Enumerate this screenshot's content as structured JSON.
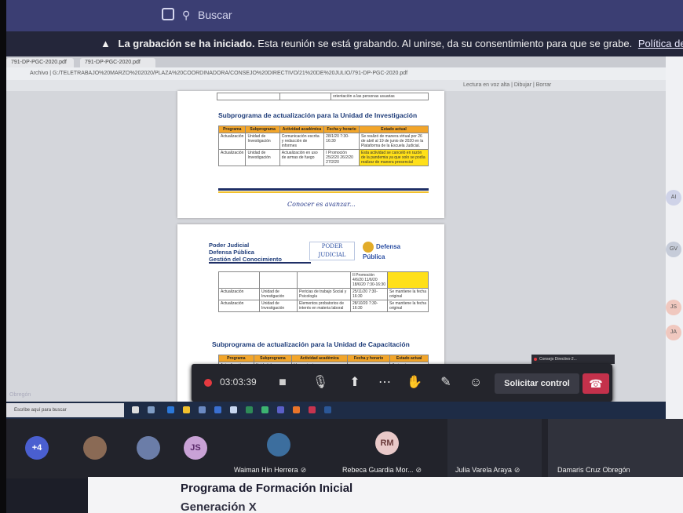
{
  "teams_top": {
    "search_label": "Buscar"
  },
  "recording_banner": {
    "bold": "La grabación se ha iniciado.",
    "text": "Esta reunión se está grabando. Al unirse, da su consentimiento para que se grabe.",
    "link": "Política de privacidad"
  },
  "browser": {
    "tabs": [
      "791-DP-PGC-2020.pdf",
      "791-DP-PGC-2020.pdf"
    ],
    "address": "Archivo | G:/TELETRABAJO%20MARZO%202020/PLAZA%20COORDINADORA/CONSEJO%20DIRECTIVO/21%20DE%20JULIO/791-DP-PGC-2020.pdf",
    "pdf_toolbar": "Lectura en voz alta | Dibujar | Borrar"
  },
  "pdf": {
    "page1": {
      "top_row_text": "orientación a las personas usuarias",
      "subheading": "Subprograma de actualización para la Unidad de Investigación",
      "table_headers": [
        "Programa",
        "Subprograma",
        "Actividad académica",
        "Fecha y horario",
        "Estado actual"
      ],
      "rows": [
        [
          "Actualización",
          "Unidad de Investigación",
          "Comunicación escrita y redacción de informes",
          "28/1/20  7:30-16:30",
          "Se realizó de manera virtual por 26 de abril al 19 de junio de 2020 en la Plataforma de la Escuela Judicial."
        ],
        [
          "Actualización",
          "Unidad de Investigación",
          "Actualización en uso de armas de fuego",
          "I Promoción 25/2/20 26/2/20 27/2/20",
          "Esta actividad se canceló en razón de la pandemia ya que solo se podía realizar de manera presencial"
        ]
      ],
      "motto": "Conocer es avanzar..."
    },
    "page2": {
      "header_lines": [
        "Poder Judicial",
        "Defensa Pública",
        "Gestión del Conocimiento"
      ],
      "logo_pj": "PODER JUDICIAL",
      "logo_dp": "Defensa Pública",
      "top_cell": "II Promoción 4/6/20 11/6/20 18/6/20 7:30-16:30",
      "rows": [
        [
          "Actualización",
          "Unidad de Investigación",
          "Pericias de trabajo Social y Psicología",
          "25/11/20  7:30-16:30",
          "Se mantiene la fecha original"
        ],
        [
          "Actualización",
          "Unidad de Investigación",
          "Elementos probatorios de interés en materia laboral",
          "28/10/20  7:30-16:30",
          "Se mantiene la fecha original"
        ]
      ],
      "subheading": "Subprograma de actualización para la Unidad de Capacitación",
      "table_headers": [
        "Programa",
        "Subprograma",
        "Actividad académica",
        "Fecha y horario",
        "Estado actual"
      ],
      "partial_row": [
        "Actualización",
        "Unidad de",
        "Herramientas",
        "",
        "A ejecutar"
      ]
    }
  },
  "meeting_controls": {
    "timer": "03:03:39",
    "request_control": "Solicitar control"
  },
  "presenter_chip": "Consejo Directivo-2...",
  "taskbar": {
    "search_placeholder": "Escribe aquí para buscar",
    "user_name": "Obregón"
  },
  "participants": [
    {
      "initials": "+4",
      "name": ""
    },
    {
      "initials": "",
      "name": ""
    },
    {
      "initials": "",
      "name": ""
    },
    {
      "initials": "JS",
      "name": ""
    },
    {
      "initials": "",
      "name": "Waiman Hin Herrera"
    },
    {
      "initials": "RM",
      "name": "Rebeca Guardia Mor..."
    },
    {
      "initials": "",
      "name": "Julia Varela Araya"
    },
    {
      "initials": "",
      "name": "Damaris Cruz Obregón"
    }
  ],
  "right_sidebar": [
    "AI",
    "GV",
    "JS",
    "JA",
    "RM"
  ],
  "bottom_slide": {
    "title": "Programa de Formación Inicial",
    "subtitle": "Generación X"
  },
  "colors": {
    "teams_purple": "#3b3e73",
    "hangup_red": "#c4314b",
    "table_header": "#f2a52a",
    "highlight": "#ffe01a"
  }
}
